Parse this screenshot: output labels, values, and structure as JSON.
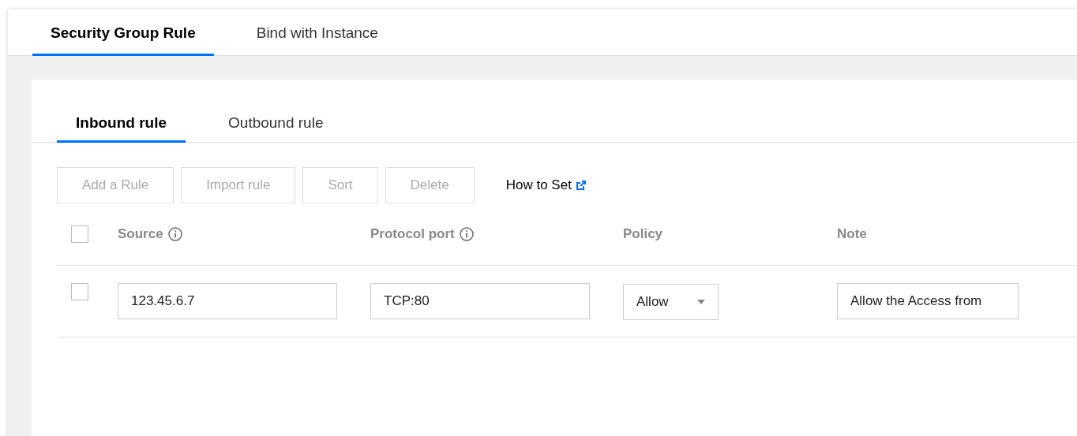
{
  "tabs": [
    {
      "label": "Security Group Rule",
      "selected": true
    },
    {
      "label": "Bind with Instance",
      "selected": false
    }
  ],
  "rule_tabs": [
    {
      "label": "Inbound rule",
      "selected": true
    },
    {
      "label": "Outbound rule",
      "selected": false
    }
  ],
  "toolbar": {
    "buttons": [
      {
        "label": "Add a Rule",
        "disabled": true
      },
      {
        "label": "Import rule",
        "disabled": true
      },
      {
        "label": "Sort",
        "disabled": true
      },
      {
        "label": "Delete",
        "disabled": true
      }
    ],
    "help_link": "How to Set"
  },
  "table": {
    "select_all": {
      "checked": false
    },
    "columns": [
      {
        "label": "Source",
        "kind": "info"
      },
      {
        "label": "Protocol port",
        "kind": "info"
      },
      {
        "label": "Policy",
        "kind": "plain"
      },
      {
        "label": "Note",
        "kind": "plain"
      }
    ],
    "rows": [
      {
        "checked": false,
        "source": "123.45.6.7",
        "protocol_port": "TCP:80",
        "policy": "Allow",
        "note": "Allow the Access from"
      }
    ]
  }
}
